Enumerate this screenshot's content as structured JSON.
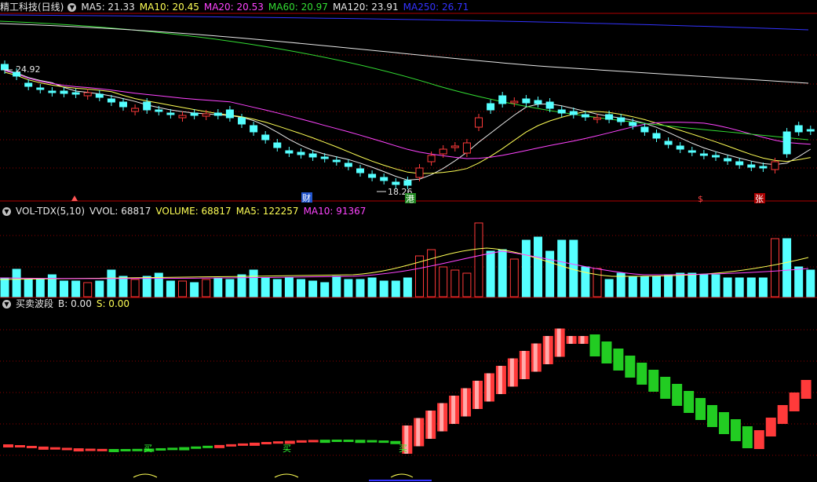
{
  "price_panel": {
    "stock_title": "精工科技(日线)",
    "indicators": [
      {
        "label": "MA5: 21.33",
        "color": "#e8e8e8"
      },
      {
        "label": "MA10: 20.45",
        "color": "#ffff55"
      },
      {
        "label": "MA20: 20.53",
        "color": "#ff44ff"
      },
      {
        "label": "MA60: 20.97",
        "color": "#33dd33"
      },
      {
        "label": "MA120: 23.91",
        "color": "#e8e8e8"
      },
      {
        "label": "MA250: 26.71",
        "color": "#3333ff"
      }
    ],
    "high_label": "24.92",
    "low_label": "18.26",
    "markers": {
      "cai": "财",
      "gang": "港",
      "dollar": "$",
      "zhang": "张"
    }
  },
  "volume_panel": {
    "indicators": [
      {
        "label": "VOL-TDX(5,10)",
        "color": "#e8e8e8"
      },
      {
        "label": "VVOL: 68817",
        "color": "#e8e8e8"
      },
      {
        "label": "VOLUME: 68817",
        "color": "#ffff55"
      },
      {
        "label": "MA5: 122257",
        "color": "#ffff55"
      },
      {
        "label": "MA10: 91367",
        "color": "#ff44ff"
      }
    ]
  },
  "wave_panel": {
    "indicators": [
      {
        "label": "买卖波段",
        "color": "#e8e8e8"
      },
      {
        "label": "B: 0.00",
        "color": "#e8e8e8"
      },
      {
        "label": "S: 0.00",
        "color": "#ffff55"
      }
    ],
    "buy_signal_label": "买"
  },
  "colors": {
    "up": "#ff3a3a",
    "down": "#55ffff",
    "wave_up": "#ff3a3a",
    "wave_down": "#22cc22",
    "grid": "#8b0000"
  }
}
